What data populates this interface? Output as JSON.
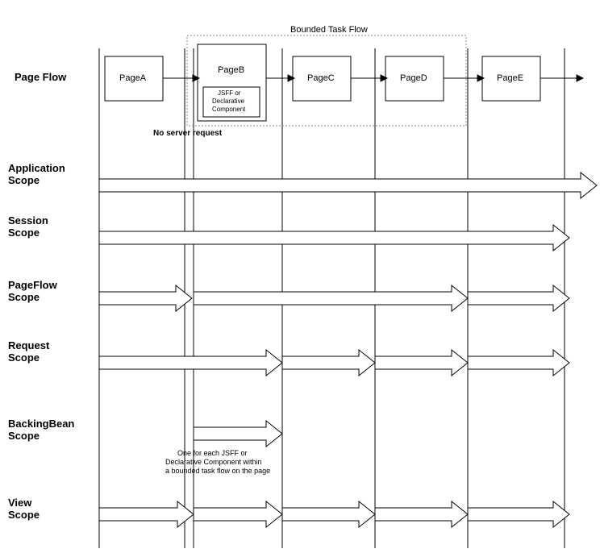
{
  "chart_data": {
    "type": "diagram",
    "title": "Bounded Task Flow",
    "pages": [
      "PageA",
      "PageB",
      "PageC",
      "PageD",
      "PageE"
    ],
    "bounded_task_flow_pages": [
      "PageB",
      "PageC",
      "PageD"
    ],
    "pageB_component": [
      "JSFF or",
      "Declarative",
      "Component"
    ],
    "no_server_request_note": "No server request",
    "backingbean_note": [
      "One for each JSFF or",
      "Declarative Component within",
      "a bounded task flow on the page"
    ],
    "row_labels": {
      "page_flow": "Page Flow",
      "application_scope": [
        "Application",
        "Scope"
      ],
      "session_scope": [
        "Session",
        "Scope"
      ],
      "pageflow_scope": [
        "PageFlow",
        "Scope"
      ],
      "request_scope": [
        "Request",
        "Scope"
      ],
      "backingbean_scope": [
        "BackingBean",
        "Scope"
      ],
      "view_scope": [
        "View",
        "Scope"
      ]
    },
    "scopes": [
      {
        "name": "Application Scope",
        "spans": [
          {
            "from": "PageA_start",
            "to": "beyond_PageE"
          }
        ]
      },
      {
        "name": "Session Scope",
        "spans": [
          {
            "from": "PageA_start",
            "to": "PageE_end"
          }
        ]
      },
      {
        "name": "PageFlow Scope",
        "spans": [
          {
            "from": "PageA_start",
            "to": "PageB_start"
          },
          {
            "from": "PageB_start",
            "to": "PageE_start"
          },
          {
            "from": "PageE_start",
            "to": "PageE_end"
          }
        ]
      },
      {
        "name": "Request Scope",
        "spans": [
          {
            "from": "PageA_start",
            "to": "PageC_start"
          },
          {
            "from": "PageC_start",
            "to": "PageD_start"
          },
          {
            "from": "PageD_start",
            "to": "PageE_start"
          },
          {
            "from": "PageE_start",
            "to": "PageE_end"
          }
        ]
      },
      {
        "name": "BackingBean Scope",
        "spans": [
          {
            "from": "PageB_start",
            "to": "PageC_start"
          }
        ]
      },
      {
        "name": "View Scope",
        "spans": [
          {
            "from": "PageA_start",
            "to": "PageB_start"
          },
          {
            "from": "PageB_start",
            "to": "PageC_start"
          },
          {
            "from": "PageC_start",
            "to": "PageD_start"
          },
          {
            "from": "PageD_start",
            "to": "PageE_start"
          },
          {
            "from": "PageE_start",
            "to": "PageE_end"
          }
        ]
      }
    ]
  }
}
